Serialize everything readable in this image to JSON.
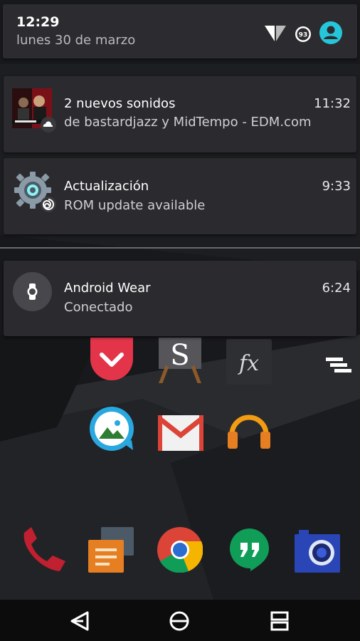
{
  "status": {
    "time": "12:29",
    "date": "lunes 30 de marzo",
    "battery_level": "93"
  },
  "notifications": [
    {
      "title": "2 nuevos sonidos",
      "text": "de bastardjazz y MidTempo - EDM.com",
      "time": "11:32",
      "icon": "album-art"
    },
    {
      "title": "Actualización",
      "text": "ROM update available",
      "time": "9:33",
      "icon": "gear-icon"
    },
    {
      "title": "Android Wear",
      "text": "Conectado",
      "time": "6:24",
      "icon": "watch-icon"
    }
  ],
  "launcher": {
    "apps": [
      "pocket",
      "sketch",
      "fx-file-explorer",
      "gallery",
      "gmail",
      "play-music",
      "phone",
      "messages",
      "chrome",
      "hangouts",
      "camera"
    ],
    "accent_colors": {
      "pocket": "#e3344a",
      "gmail": "#db4437",
      "music": "#f39c12",
      "phone": "#c0202f",
      "chrome_red": "#db4437",
      "chrome_green": "#0f9d58",
      "chrome_yellow": "#f4b400",
      "hangouts": "#0f9d58",
      "camera": "#2945b6"
    }
  },
  "navigation": {
    "buttons": [
      "back",
      "home",
      "recents"
    ]
  }
}
